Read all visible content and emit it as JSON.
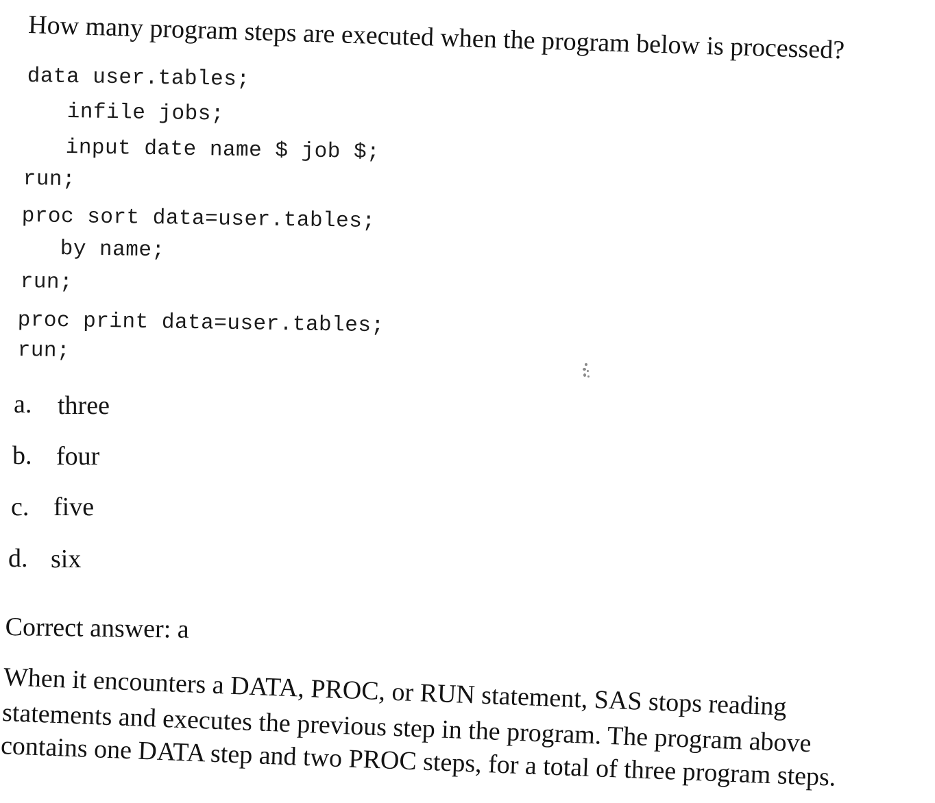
{
  "question": {
    "text": "How many program steps are executed when the program below is processed?"
  },
  "code": {
    "lines": [
      "data user.tables;",
      "infile jobs;",
      "input date name $ job $;",
      "run;",
      "proc sort data=user.tables;",
      "by name;",
      "run;",
      "proc print data=user.tables;",
      "run;"
    ]
  },
  "options": [
    {
      "letter": "a.",
      "text": "three"
    },
    {
      "letter": "b.",
      "text": "four"
    },
    {
      "letter": "c.",
      "text": "five"
    },
    {
      "letter": "d.",
      "text": "six"
    }
  ],
  "answer": {
    "text": "Correct answer: a"
  },
  "explanation": {
    "lines": [
      "When it encounters a DATA, PROC, or RUN statement, SAS stops reading",
      "statements and executes the previous step in the program. The program above",
      "contains one DATA step and two PROC steps, for a total of three program steps."
    ]
  }
}
